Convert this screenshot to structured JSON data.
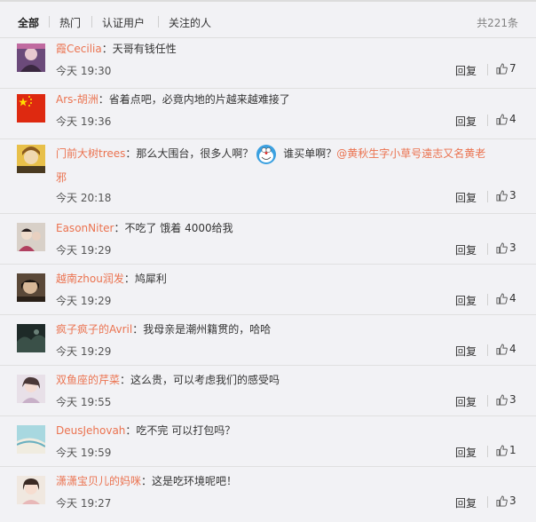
{
  "tabs": {
    "all": "全部",
    "hot": "热门",
    "verified": "认证用户",
    "following": "关注的人"
  },
  "total": "共221条",
  "reply_label": "回复",
  "comments": [
    {
      "user": "霞Cecilia",
      "text": "：天哥有钱任性",
      "time": "今天 19:30",
      "likes": "7"
    },
    {
      "user": "Ars-胡洲",
      "text": "：省着点吧，必竟内地的片越来越难接了",
      "time": "今天 19:36",
      "likes": "4"
    },
    {
      "user": "门前大树trees",
      "text_a": "：那么大围台，很多人啊？",
      "emoji": "doraemon-emoji",
      "text_b": " 谁买单啊？",
      "mention": "@黄秋生字小草号遠志又名黄老",
      "mention_wrap": "邪",
      "time": "今天 20:18",
      "likes": "3"
    },
    {
      "user": "EasonNiter",
      "text": "：不吃了 饿着 4000给我",
      "time": "今天 19:29",
      "likes": "3"
    },
    {
      "user": "越南zhou润发",
      "text": "：鸠犀利",
      "time": "今天 19:29",
      "likes": "4"
    },
    {
      "user": "疯子疯子的Avril",
      "text": "：我母亲是潮州籍贯的，哈哈",
      "time": "今天 19:29",
      "likes": "4"
    },
    {
      "user": "双鱼座的芹菜",
      "text": "：这么贵，可以考虑我们的感受吗",
      "time": "今天 19:55",
      "likes": "3"
    },
    {
      "user": "DeusJehovah",
      "text": "：吃不完 可以打包吗？",
      "time": "今天 19:59",
      "likes": "1"
    },
    {
      "user": "潇潇宝贝儿的妈咪",
      "text": "：这是吃环境呢吧！",
      "time": "今天 19:27",
      "likes": "3"
    }
  ],
  "colors": {
    "username": "#eb7350",
    "background": "#f2f2f5",
    "divider": "#e0e0e0"
  },
  "icons": {
    "like": "thumbs-up-icon",
    "emoji": "doraemon-emoji"
  }
}
